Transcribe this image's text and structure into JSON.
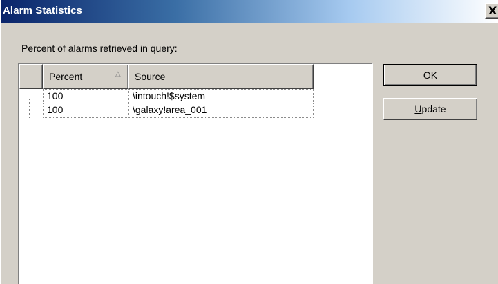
{
  "window": {
    "title": "Alarm Statistics",
    "close_glyph": "X"
  },
  "query_label": "Percent of alarms retrieved in query:",
  "list": {
    "columns": [
      {
        "label": "Percent",
        "sort": "ascending"
      },
      {
        "label": "Source"
      }
    ],
    "rows": [
      {
        "percent": "100",
        "source": "\\intouch!$system"
      },
      {
        "percent": "100",
        "source": "\\galaxy!area_001"
      }
    ]
  },
  "buttons": {
    "ok_label": "OK",
    "update_accel": "U",
    "update_rest": "pdate"
  },
  "icons": {
    "close": "close-icon",
    "sort": "sort-ascending-icon"
  },
  "colors": {
    "title_start": "#0a246a",
    "title_end": "#ffffff",
    "window_bg": "#d4d0c8"
  }
}
